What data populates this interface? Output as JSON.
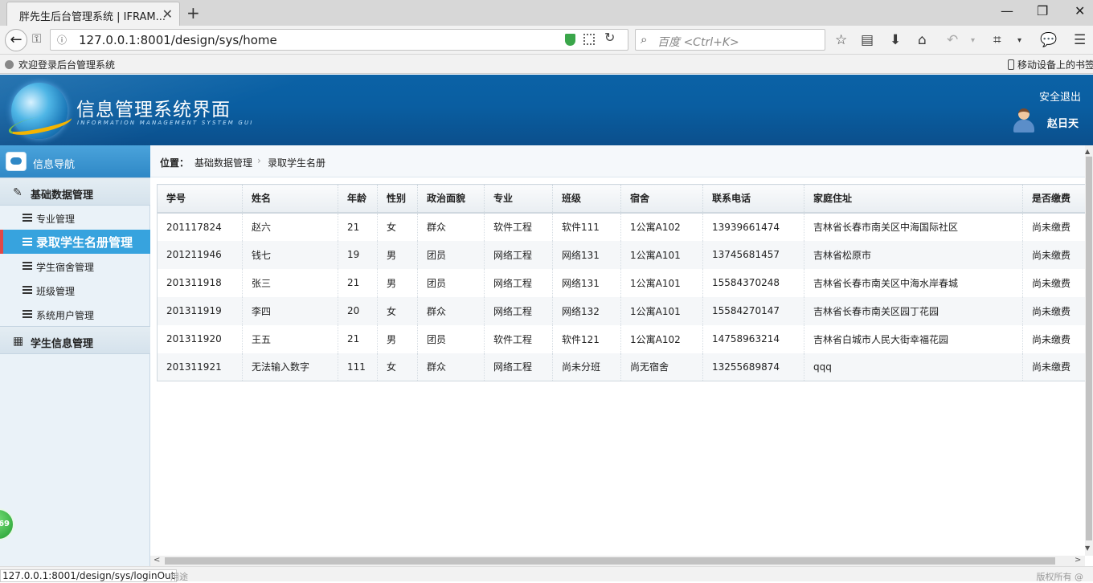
{
  "browser": {
    "tab_title": "胖先生后台管理系统 | IFRAM...",
    "url": "127.0.0.1:8001/design/sys/home",
    "search_placeholder": "百度 <Ctrl+K>",
    "bookmark_label": "欢迎登录后台管理系统",
    "mobile_bookmarks_label": "移动设备上的书签",
    "status_url": "127.0.0.1:8001/design/sys/loginOut",
    "status_hint": "用途",
    "status_copyright": "版权所有 @"
  },
  "header": {
    "title": "信息管理系统界面",
    "subtitle": "INFORMATION MANAGEMENT SYSTEM GUI",
    "logout_label": "安全退出",
    "user_name": "赵日天"
  },
  "sidebar": {
    "header_label": "信息导航",
    "groups": [
      {
        "label": "基础数据管理",
        "items": [
          {
            "label": "专业管理"
          },
          {
            "label": "录取学生名册管理"
          },
          {
            "label": "学生宿舍管理"
          },
          {
            "label": "班级管理"
          },
          {
            "label": "系统用户管理"
          }
        ]
      },
      {
        "label": "学生信息管理"
      }
    ],
    "badge": "69"
  },
  "breadcrumb": {
    "lead": "位置：",
    "parent": "基础数据管理",
    "current": "录取学生名册"
  },
  "table": {
    "columns": [
      "学号",
      "姓名",
      "年龄",
      "性别",
      "政治面貌",
      "专业",
      "班级",
      "宿舍",
      "联系电话",
      "家庭住址",
      "是否缴费"
    ],
    "rows": [
      [
        "201117824",
        "赵六",
        "21",
        "女",
        "群众",
        "软件工程",
        "软件111",
        "1公寓A102",
        "13939661474",
        "吉林省长春市南关区中海国际社区",
        "尚未缴费"
      ],
      [
        "201211946",
        "钱七",
        "19",
        "男",
        "团员",
        "网络工程",
        "网络131",
        "1公寓A101",
        "13745681457",
        "吉林省松原市",
        "尚未缴费"
      ],
      [
        "201311918",
        "张三",
        "21",
        "男",
        "团员",
        "网络工程",
        "网络131",
        "1公寓A101",
        "15584370248",
        "吉林省长春市南关区中海水岸春城",
        "尚未缴费"
      ],
      [
        "201311919",
        "李四",
        "20",
        "女",
        "群众",
        "网络工程",
        "网络132",
        "1公寓A101",
        "15584270147",
        "吉林省长春市南关区园丁花园",
        "尚未缴费"
      ],
      [
        "201311920",
        "王五",
        "21",
        "男",
        "团员",
        "软件工程",
        "软件121",
        "1公寓A102",
        "14758963214",
        "吉林省白城市人民大街幸福花园",
        "尚未缴费"
      ],
      [
        "201311921",
        "无法输入数字",
        "111",
        "女",
        "群众",
        "网络工程",
        "尚未分班",
        "尚无宿舍",
        "13255689874",
        "qqq",
        "尚未缴费"
      ]
    ]
  }
}
